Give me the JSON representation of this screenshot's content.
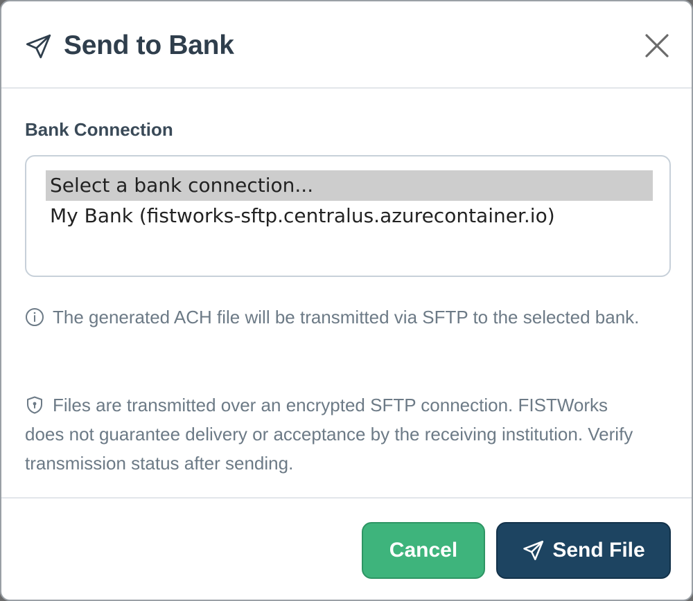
{
  "dialog": {
    "title": "Send to Bank",
    "title_icon": "paper-plane-icon",
    "close_icon": "close-icon"
  },
  "bank_connection": {
    "label": "Bank Connection",
    "options": [
      "Select a bank connection...",
      "My Bank (fistworks-sftp.centralus.azurecontainer.io)"
    ],
    "selected_index": 0
  },
  "notes": {
    "info_icon": "info-circle-icon",
    "info_text": "The generated ACH file will be transmitted via SFTP to the selected bank.",
    "security_icon": "shield-icon",
    "security_text": "Files are transmitted over an encrypted SFTP connection. FISTWorks does not guarantee delivery or acceptance by the receiving institution. Verify transmission status after sending."
  },
  "footer": {
    "cancel_label": "Cancel",
    "send_label": "Send File",
    "send_icon": "paper-plane-icon"
  },
  "colors": {
    "title": "#2f3e4c",
    "cancel_bg": "#3eb47c",
    "send_bg": "#1d4461",
    "selected_option_bg": "#cdcdcd",
    "muted_text": "#6c7a86"
  }
}
